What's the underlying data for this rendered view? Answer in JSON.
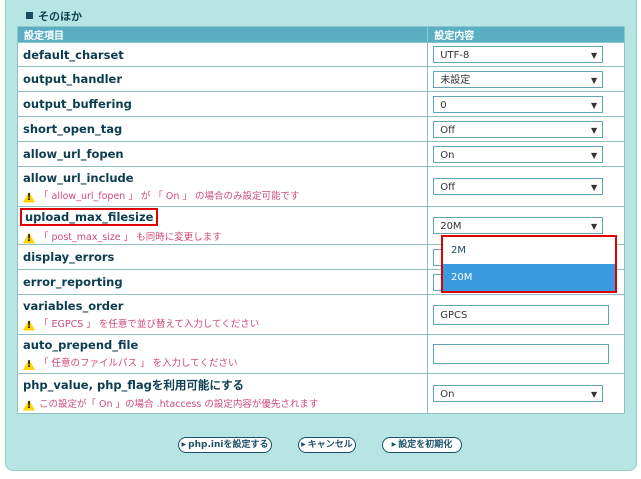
{
  "section": {
    "title": "そのほか"
  },
  "table": {
    "col_item": "設定項目",
    "col_value": "設定内容"
  },
  "rows": [
    {
      "name": "default_charset",
      "value": "UTF-8",
      "type": "select"
    },
    {
      "name": "output_handler",
      "value": "未設定",
      "type": "select"
    },
    {
      "name": "output_buffering",
      "value": "0",
      "type": "select"
    },
    {
      "name": "short_open_tag",
      "value": "Off",
      "type": "select"
    },
    {
      "name": "allow_url_fopen",
      "value": "On",
      "type": "select"
    },
    {
      "name": "allow_url_include",
      "value": "Off",
      "type": "select",
      "note": "「 allow_url_fopen 」 が 「 On 」 の場合のみ設定可能です"
    },
    {
      "name": "upload_max_filesize",
      "value": "20M",
      "type": "select",
      "note": "「 post_max_size 」 も同時に変更します"
    },
    {
      "name": "display_errors",
      "value": "",
      "type": "select"
    },
    {
      "name": "error_reporting",
      "value": "",
      "type": "select"
    },
    {
      "name": "variables_order",
      "value": "GPCS",
      "type": "text",
      "note": "「 EGPCS 」 を任意で並び替えて入力してください"
    },
    {
      "name": "auto_prepend_file",
      "value": "",
      "type": "text",
      "note": "「 任意のファイルパス 」 を入力してください"
    },
    {
      "name": "php_value, php_flagを利用可能にする",
      "value": "On",
      "type": "select",
      "note": "この設定が「 On 」の場合 .htaccess の設定内容が優先されます"
    }
  ],
  "dropdown": {
    "options": [
      "2M",
      "20M"
    ],
    "selected": "20M"
  },
  "buttons": {
    "apply": "php.iniを設定する",
    "cancel": "キャンセル",
    "reset": "設定を初期化"
  },
  "colors": {
    "panel_bg": "#b6e5e3",
    "header_bg": "#5aaec2",
    "highlight": "#e00000",
    "option_selected": "#3a9be0"
  }
}
